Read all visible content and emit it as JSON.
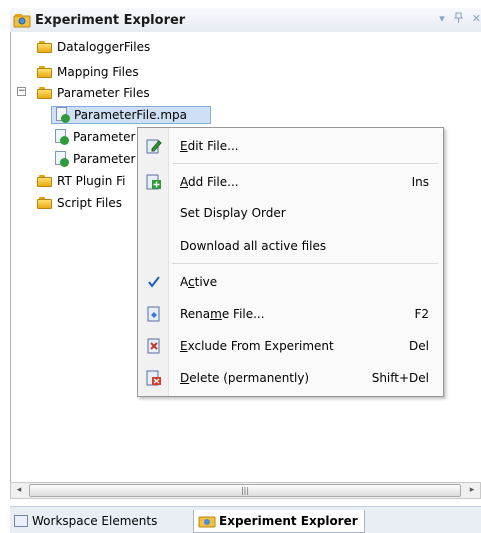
{
  "panel": {
    "title": "Experiment Explorer",
    "controls": [
      "▾",
      "ꟷ",
      "✕"
    ]
  },
  "tree": [
    {
      "label": "DataloggerFiles",
      "type": "folder"
    },
    {
      "label": "Mapping Files",
      "type": "folder"
    },
    {
      "label": "Parameter Files",
      "type": "folder",
      "expanded": true
    },
    {
      "label": "ParameterFile.mpa",
      "type": "file",
      "selected": true
    },
    {
      "label": "Parameter",
      "type": "file"
    },
    {
      "label": "Parameter",
      "type": "file"
    },
    {
      "label": "RT Plugin Fi",
      "type": "folder"
    },
    {
      "label": "Script Files",
      "type": "folder"
    }
  ],
  "expander_symbol": "−",
  "context_menu": {
    "items": [
      {
        "label_pre": "",
        "label_u": "E",
        "label_post": "dit File...",
        "shortcut": "",
        "icon": "edit-icon"
      },
      {
        "label_pre": "",
        "label_u": "A",
        "label_post": "dd File...",
        "shortcut": "Ins",
        "icon": "add-file-icon"
      },
      {
        "label_pre": "Set Display Order",
        "label_u": "",
        "label_post": "",
        "shortcut": "",
        "icon": ""
      },
      {
        "label_pre": "Download all active files",
        "label_u": "",
        "label_post": "",
        "shortcut": "",
        "icon": ""
      },
      {
        "label_pre": "A",
        "label_u": "c",
        "label_post": "tive",
        "shortcut": "",
        "icon": "checkmark-icon"
      },
      {
        "label_pre": "Rena",
        "label_u": "m",
        "label_post": "e File...",
        "shortcut": "F2",
        "icon": "rename-icon"
      },
      {
        "label_pre": "",
        "label_u": "E",
        "label_post": "xclude From Experiment",
        "shortcut": "Del",
        "icon": "exclude-icon"
      },
      {
        "label_pre": "",
        "label_u": "D",
        "label_post": "elete (permanently)",
        "shortcut": "Shift+Del",
        "icon": "delete-icon"
      }
    ]
  },
  "scrollbar": {
    "left": "◂",
    "right": "▸",
    "grip": "|||"
  },
  "bottom_tabs": [
    {
      "label": "Workspace Elements",
      "active": false
    },
    {
      "label": "Experiment Explorer",
      "active": true
    }
  ],
  "colors": {
    "selection": "#cfe0f5",
    "check": "#1f5fbf",
    "folder": "#f2c43d"
  }
}
